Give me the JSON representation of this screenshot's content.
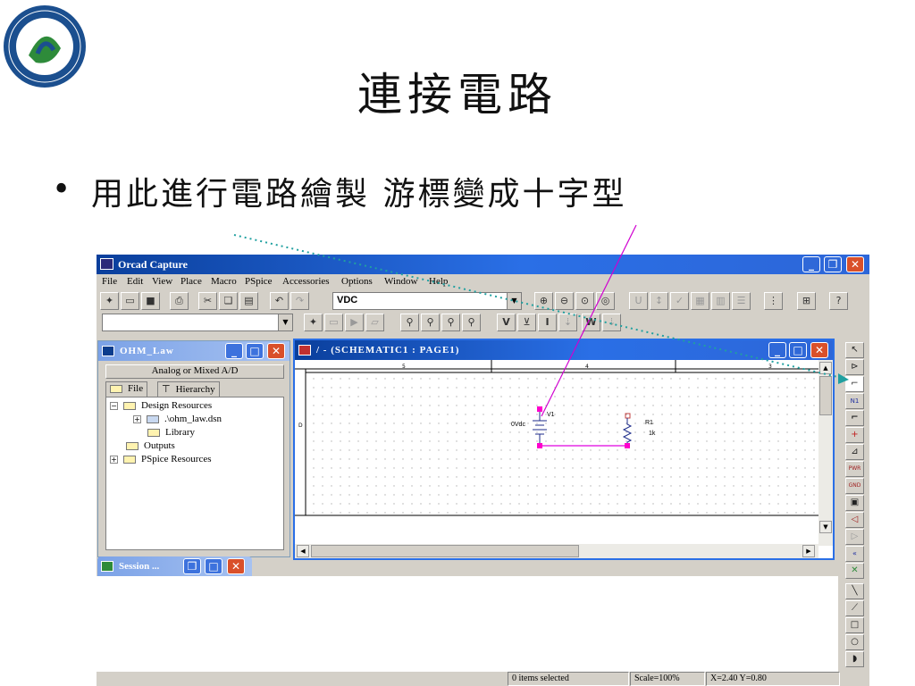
{
  "slide": {
    "title": "連接電路",
    "bullet": "用此進行電路繪製  游標變成十字型"
  },
  "app": {
    "title": "Orcad Capture",
    "menu": [
      "File",
      "Edit",
      "View",
      "Place",
      "Macro",
      "PSpice",
      "Accessories",
      "Options",
      "Window",
      "Help"
    ],
    "part_combo": "VDC",
    "probe_labels": {
      "v": "V",
      "i": "I",
      "w": "W"
    }
  },
  "project": {
    "title": "OHM_Law",
    "subtitle": "Analog or Mixed A/D",
    "tab_file": "File",
    "tab_hierarchy": "Hierarchy",
    "tree": [
      {
        "label": "Design Resources",
        "expander": "−"
      },
      {
        "label": ".\\ohm_law.dsn",
        "expander": "+"
      },
      {
        "label": "Library",
        "expander": ""
      },
      {
        "label": "Outputs",
        "expander": ""
      },
      {
        "label": "PSpice Resources",
        "expander": "+"
      }
    ]
  },
  "session": {
    "title": "Session ..."
  },
  "schematic": {
    "title": "/ - (SCHEMATIC1 : PAGE1)",
    "ruler_top": [
      "5",
      "4",
      "3"
    ],
    "ruler_left": "D",
    "v1_label": "V1",
    "v1_value": "0Vdc",
    "r1_label": "R1",
    "r1_value": "1k"
  },
  "status": {
    "selected": "0 items selected",
    "scale": "Scale=100%",
    "coords": "X=2.40  Y=0.80"
  },
  "colors": {
    "titlebar": "#2a6fe6",
    "wire": "#e000e0",
    "annotation_line": "#d000d0",
    "dotted_arrow": "#20a0a0"
  },
  "icons": {
    "palette": [
      "pointer",
      "part",
      "wire",
      "net-alias",
      "bus",
      "junction",
      "bus-entry",
      "power",
      "ground",
      "hierarchical-block",
      "port",
      "pin",
      "off-page",
      "no-connect",
      "line",
      "polyline",
      "rectangle",
      "ellipse",
      "arc",
      "text"
    ]
  }
}
